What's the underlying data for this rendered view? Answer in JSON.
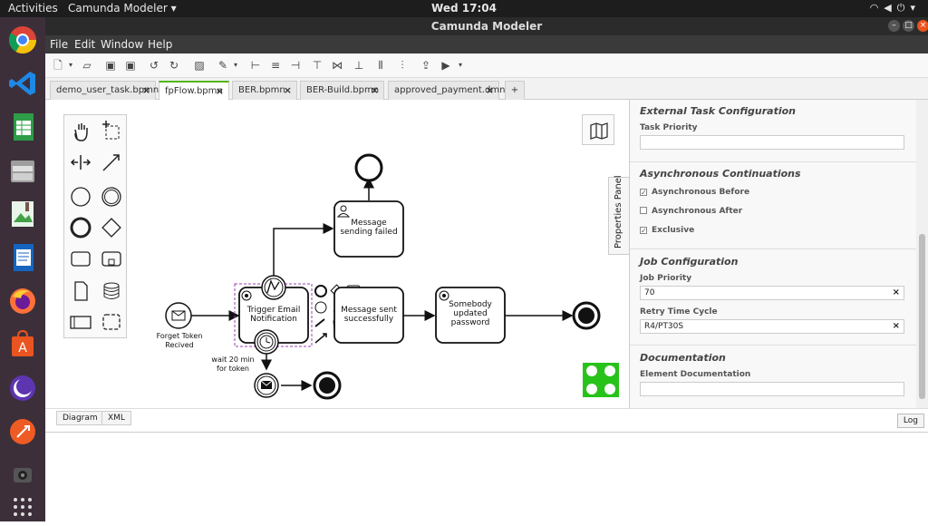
{
  "system": {
    "activities": "Activities",
    "app_name": "Camunda Modeler",
    "clock": "Wed 17:04"
  },
  "window": {
    "title": "Camunda Modeler"
  },
  "menu": [
    "File",
    "Edit",
    "Window",
    "Help"
  ],
  "tabs": [
    {
      "label": "demo_user_task.bpmn",
      "active": false
    },
    {
      "label": "fpFlow.bpmn",
      "active": true
    },
    {
      "label": "BER.bpmn",
      "active": false
    },
    {
      "label": "BER-Build.bpmn",
      "active": false
    },
    {
      "label": "approved_payment.dmn",
      "active": false
    }
  ],
  "new_tab_label": "+",
  "diagram": {
    "start_event_label": "Forget Token Recived",
    "task_trigger": "Trigger Email Notification",
    "task_message_sent": "Message sent successfully",
    "task_updated": "Somebody updated password",
    "task_failed": "Message sending failed",
    "timer_label": "wait 20 min for token"
  },
  "properties_panel_label": "Properties Panel",
  "properties": {
    "external_task": {
      "header": "External Task Configuration",
      "task_priority_label": "Task Priority",
      "task_priority_value": ""
    },
    "async": {
      "header": "Asynchronous Continuations",
      "before": "Asynchronous Before",
      "after": "Asynchronous After",
      "exclusive": "Exclusive"
    },
    "job": {
      "header": "Job Configuration",
      "priority_label": "Job Priority",
      "priority_value": "70",
      "retry_label": "Retry Time Cycle",
      "retry_value": "R4/PT30S"
    },
    "documentation": {
      "header": "Documentation",
      "element_doc_label": "Element Documentation",
      "element_doc_value": ""
    }
  },
  "bottom": {
    "diagram_tab": "Diagram",
    "xml_tab": "XML",
    "log_button": "Log"
  },
  "colors": {
    "accent": "#52b415",
    "selection": "#9b3fb5"
  },
  "checkbox_states": {
    "async_before": true,
    "async_after": false,
    "exclusive": true
  }
}
